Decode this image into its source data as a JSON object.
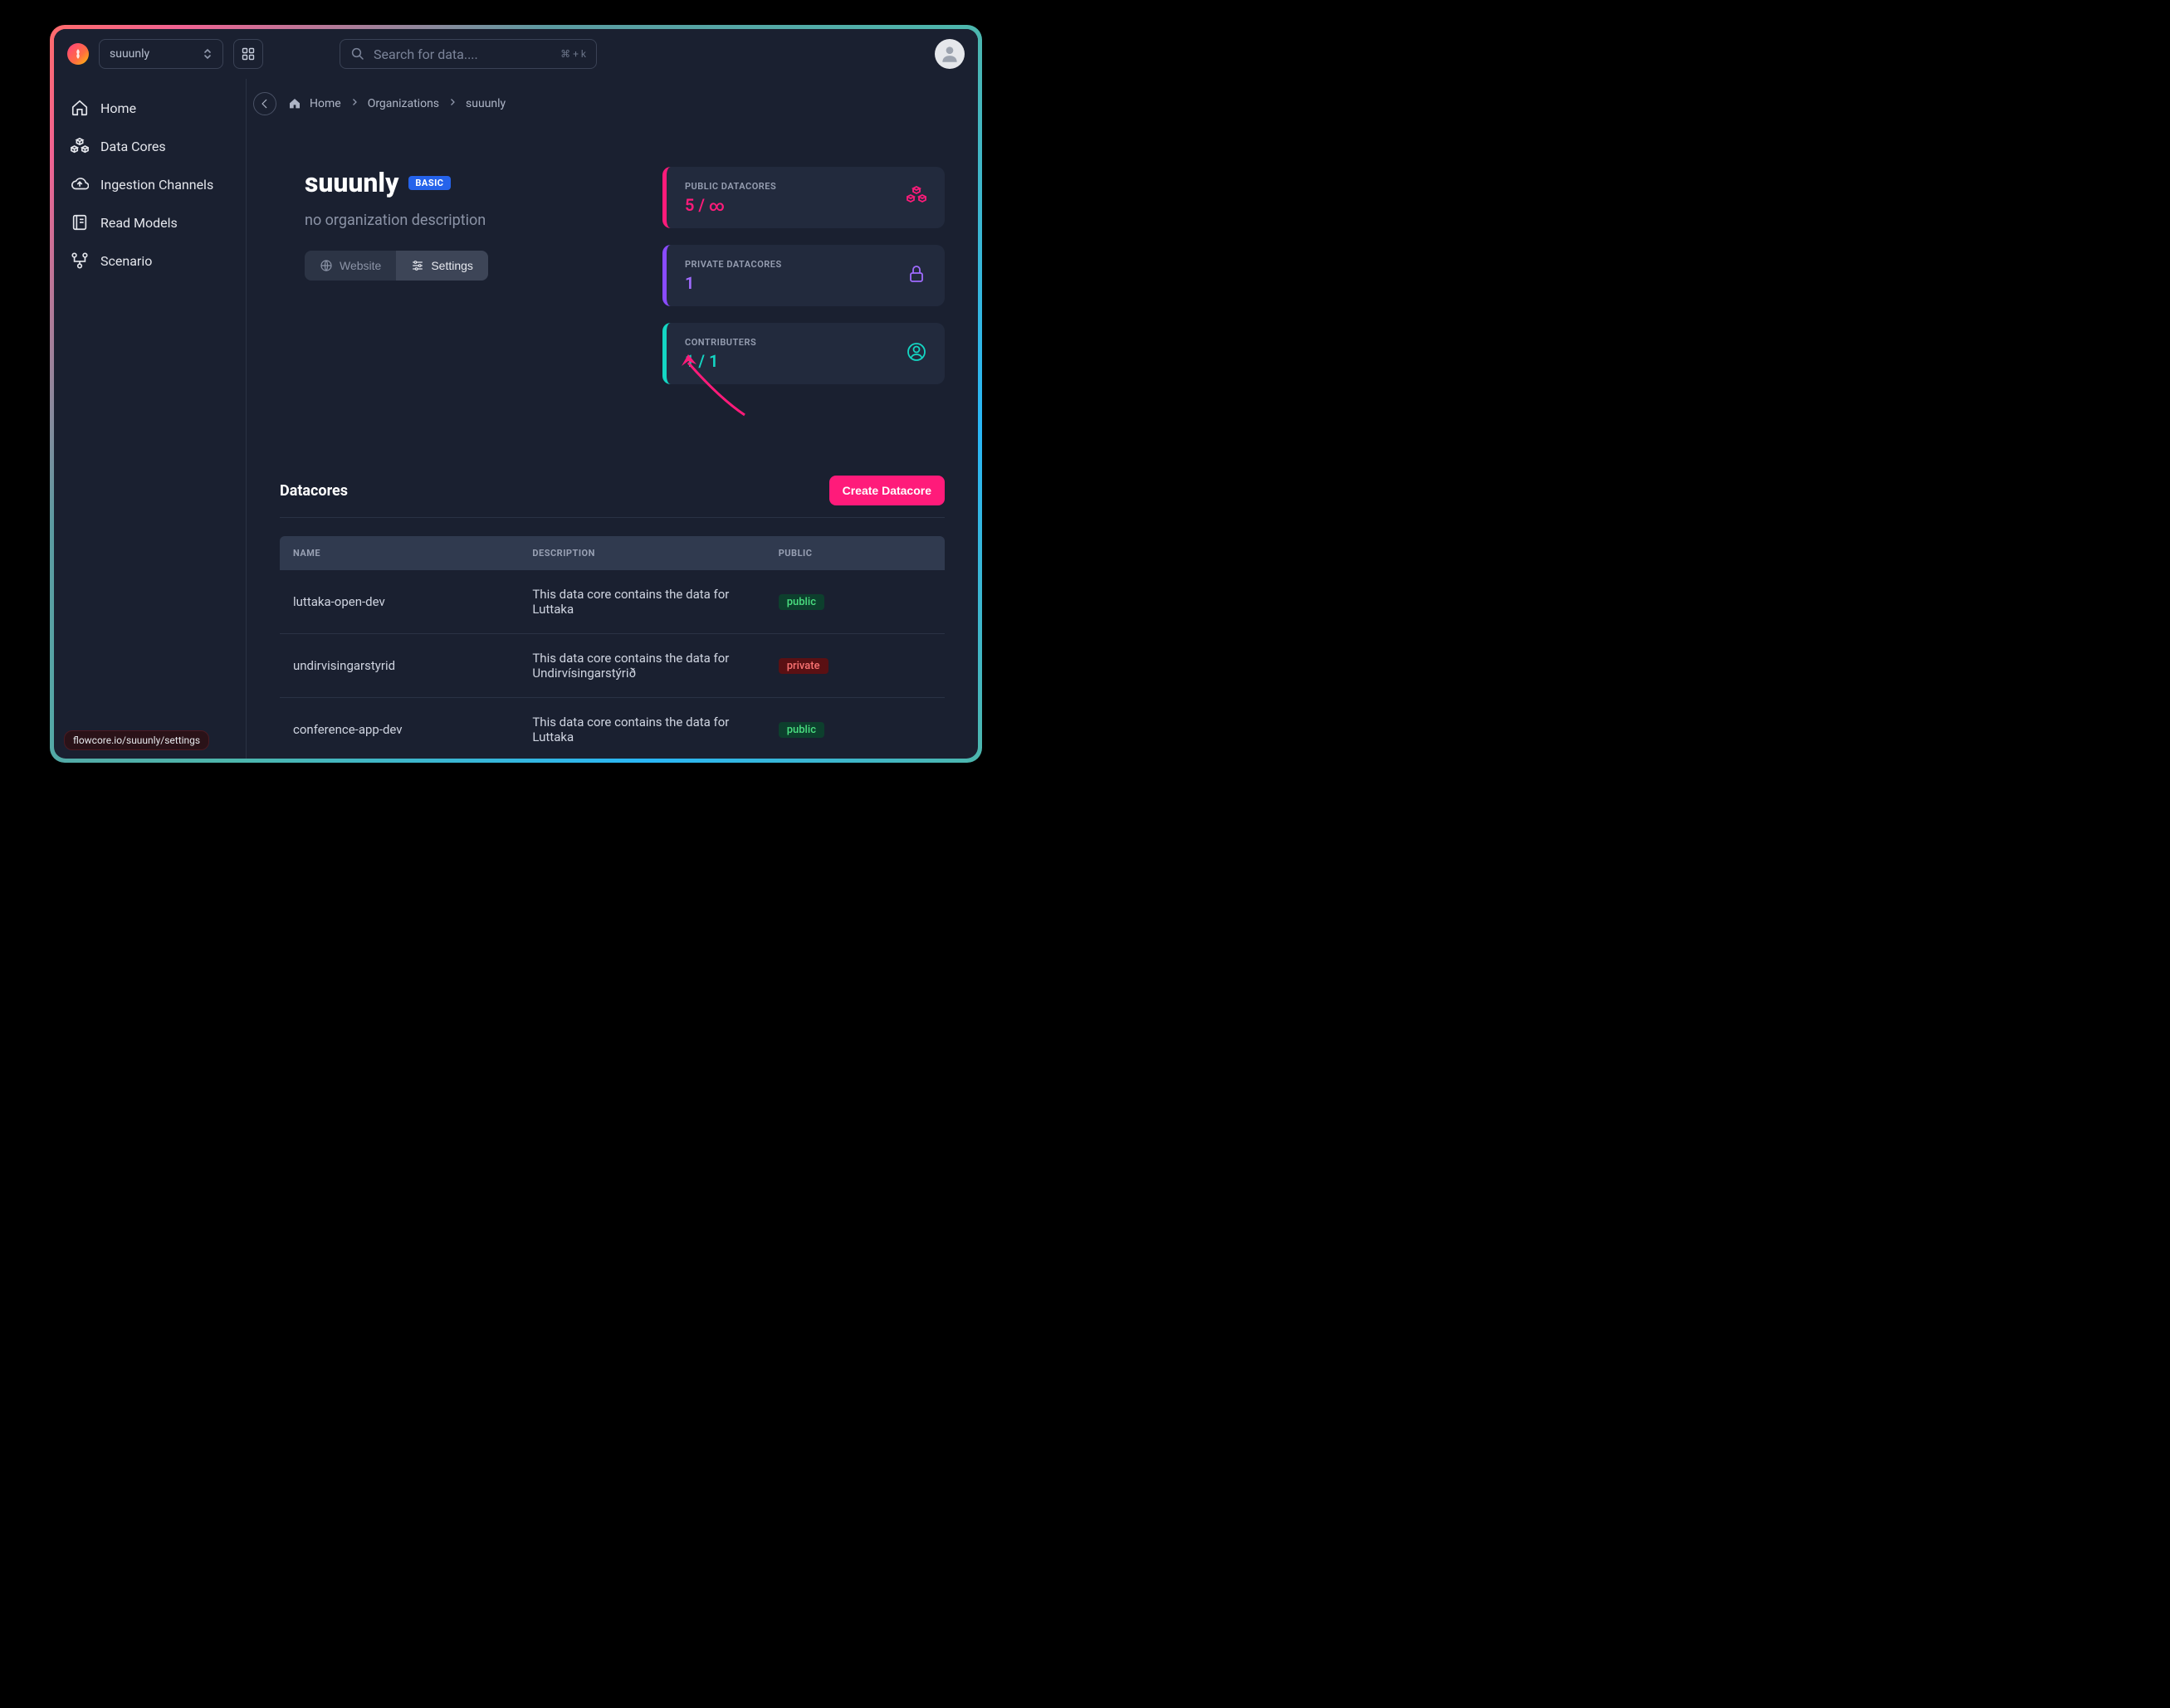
{
  "topbar": {
    "org_select": "suuunly",
    "search_placeholder": "Search for data....",
    "search_kbd": "⌘ + k"
  },
  "sidebar": {
    "home": "Home",
    "datacores": "Data Cores",
    "ingestion": "Ingestion Channels",
    "readmodels": "Read Models",
    "scenario": "Scenario"
  },
  "breadcrumbs": {
    "home": "Home",
    "orgs": "Organizations",
    "current": "suuunly"
  },
  "org": {
    "name": "suuunly",
    "plan": "BASIC",
    "desc": "no organization description",
    "website_btn": "Website",
    "settings_btn": "Settings"
  },
  "stats": {
    "public_label": "PUBLIC DATACORES",
    "public_val": "5 / ",
    "public_inf": "∞",
    "private_label": "PRIVATE DATACORES",
    "private_val": "1",
    "contrib_label": "CONTRIBUTERS",
    "contrib_val": "1 / 1"
  },
  "dc": {
    "section_title": "Datacores",
    "create_btn": "Create Datacore",
    "th_name": "NAME",
    "th_desc": "DESCRIPTION",
    "th_public": "PUBLIC",
    "rows": [
      {
        "name": "luttaka-open-dev",
        "desc": "This data core contains the data for Luttaka",
        "tag": "public"
      },
      {
        "name": "undirvisingarstyrid",
        "desc": "This data core contains the data for Undirvísingarstýrið",
        "tag": "private"
      },
      {
        "name": "conference-app-dev",
        "desc": "This data core contains the data for Luttaka",
        "tag": "public"
      }
    ]
  },
  "toast": "flowcore.io/suuunly/settings"
}
